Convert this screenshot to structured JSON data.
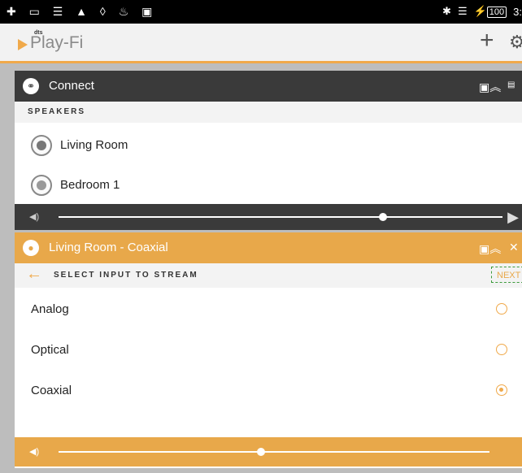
{
  "status_bar": {
    "left_icons": "✚ ▭ ☰ ▲ ◊ ♨ ▣",
    "battery": "100",
    "time": "3:"
  },
  "app_bar": {
    "logo_brand": "dts",
    "logo_text": "Play-Fi",
    "add_icon": "plus-icon",
    "settings_icon": "gear-icon"
  },
  "connect_panel": {
    "title": "Connect",
    "section_label": "SPEAKERS",
    "speakers": [
      {
        "name": "Living Room"
      },
      {
        "name": "Bedroom 1"
      }
    ],
    "volume": 0.73
  },
  "zone_panel": {
    "title": "Living Room - Coaxial",
    "section_label": "SELECT INPUT TO STREAM",
    "next_label": "NEXT",
    "inputs": [
      {
        "name": "Analog",
        "selected": false
      },
      {
        "name": "Optical",
        "selected": false
      },
      {
        "name": "Coaxial",
        "selected": true
      }
    ],
    "volume": 0.47
  },
  "colors": {
    "accent": "#e8a84a",
    "dark_header": "#3a3a3a"
  }
}
